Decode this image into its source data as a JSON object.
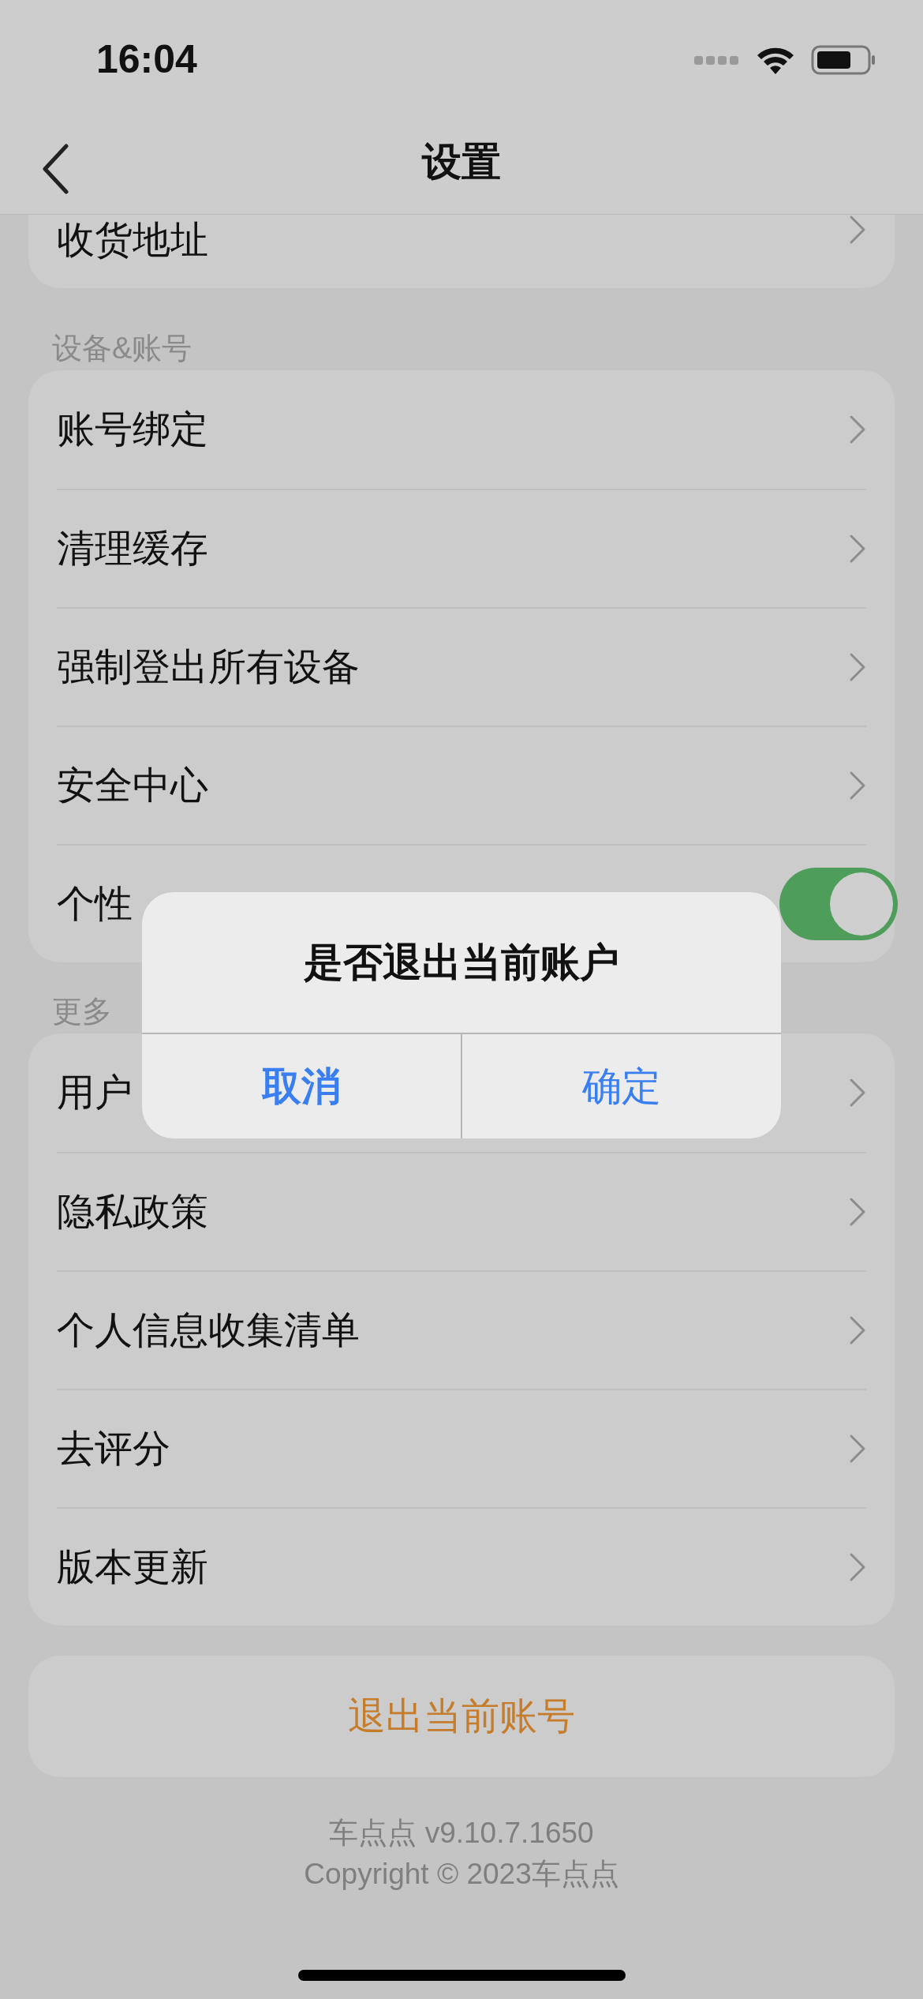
{
  "status_bar": {
    "time": "16:04"
  },
  "nav": {
    "title": "设置"
  },
  "sections": [
    {
      "items": [
        {
          "label": "收货地址",
          "kind": "link"
        }
      ]
    },
    {
      "header": "设备&账号",
      "items": [
        {
          "label": "账号绑定",
          "kind": "link"
        },
        {
          "label": "清理缓存",
          "kind": "link"
        },
        {
          "label": "强制登出所有设备",
          "kind": "link"
        },
        {
          "label": "安全中心",
          "kind": "link"
        },
        {
          "label": "个性",
          "kind": "toggle",
          "on": true
        }
      ]
    },
    {
      "header": "更多",
      "items": [
        {
          "label": "用户",
          "kind": "link"
        },
        {
          "label": "隐私政策",
          "kind": "link"
        },
        {
          "label": "个人信息收集清单",
          "kind": "link"
        },
        {
          "label": "去评分",
          "kind": "link"
        },
        {
          "label": "版本更新",
          "kind": "link"
        }
      ]
    }
  ],
  "logout_button": "退出当前账号",
  "footer": {
    "version": "车点点 v9.10.7.1650",
    "copyright": "Copyright © 2023车点点"
  },
  "dialog": {
    "title": "是否退出当前账户",
    "buttons": [
      {
        "label": "取消",
        "kind": "cancel"
      },
      {
        "label": "确定",
        "kind": "default"
      }
    ]
  }
}
